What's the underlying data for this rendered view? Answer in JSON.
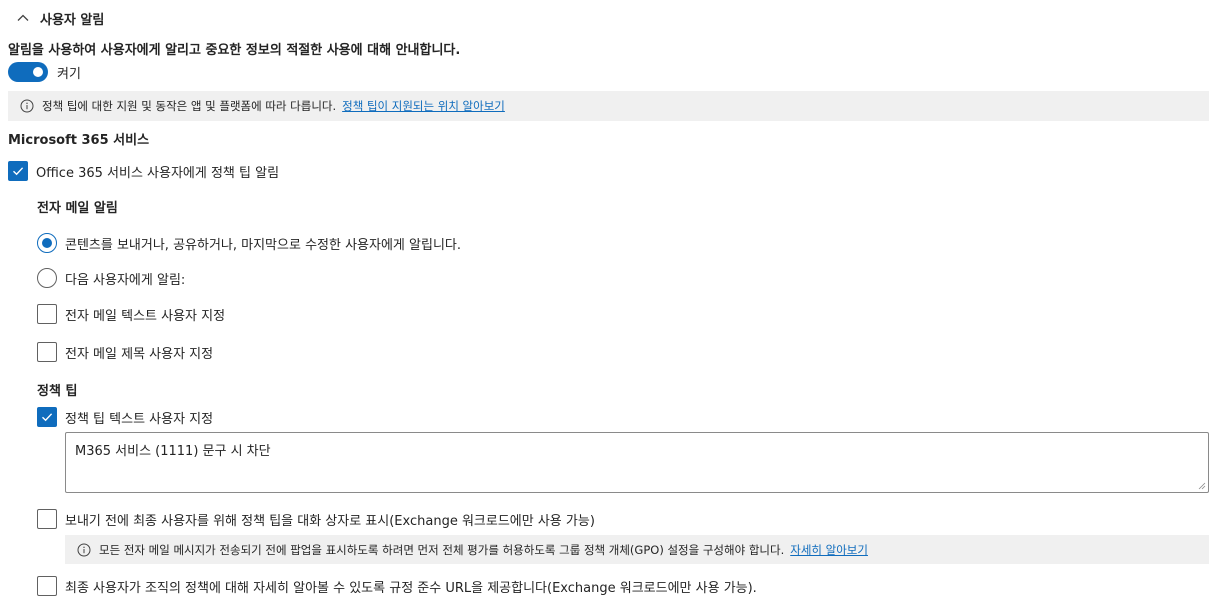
{
  "section": {
    "title": "사용자 알림",
    "expanded": true
  },
  "description": "알림을 사용하여 사용자에게 알리고 중요한 정보의 적절한 사용에 대해 안내합니다.",
  "toggle": {
    "label": "켜기",
    "on": true
  },
  "info_bar_1": {
    "text": "정책 팁에 대한 지원 및 동작은 앱 및 플랫폼에 따라 다릅니다.",
    "link": "정책 팁이 지원되는 위치 알아보기"
  },
  "m365": {
    "title": "Microsoft 365 서비스",
    "notify_checkbox": {
      "label": "Office 365 서비스 사용자에게 정책 팁 알림",
      "checked": true
    }
  },
  "email": {
    "title": "전자 메일 알림",
    "radio_1": {
      "label": "콘텐츠를 보내거나, 공유하거나, 마지막으로 수정한 사용자에게 알립니다.",
      "checked": true
    },
    "radio_2": {
      "label": "다음 사용자에게 알림:",
      "checked": false
    },
    "custom_text": {
      "label": "전자 메일 텍스트 사용자 지정",
      "checked": false
    },
    "custom_subject": {
      "label": "전자 메일 제목 사용자 지정",
      "checked": false
    }
  },
  "policy_tip": {
    "title": "정책 팁",
    "custom_text": {
      "label": "정책 팁 텍스트 사용자 지정",
      "checked": true
    },
    "text_value": "M365 서비스 (1111) 문구 시 차단",
    "dialog_checkbox": {
      "label": "보내기 전에 최종 사용자를 위해 정책 팁을 대화 상자로 표시(Exchange 워크로드에만 사용 가능)",
      "checked": false
    },
    "info_bar_2": {
      "text": "모든 전자 메일 메시지가 전송되기 전에 팝업을 표시하도록 하려면 먼저 전체 평가를 허용하도록 그룹 정책 개체(GPO) 설정을 구성해야 합니다.",
      "link": "자세히 알아보기"
    },
    "compliance_url_checkbox": {
      "label": "최종 사용자가 조직의 정책에 대해 자세히 알아볼 수 있도록 규정 준수 URL을 제공합니다(Exchange 워크로드에만 사용 가능).",
      "checked": false
    }
  },
  "colors": {
    "accent": "#0f6cbd",
    "info_bg": "#f0f0f0",
    "text": "#242424"
  },
  "icons": {
    "collapse": "chevron-up-icon",
    "info": "info-icon",
    "check": "checkmark-icon"
  }
}
